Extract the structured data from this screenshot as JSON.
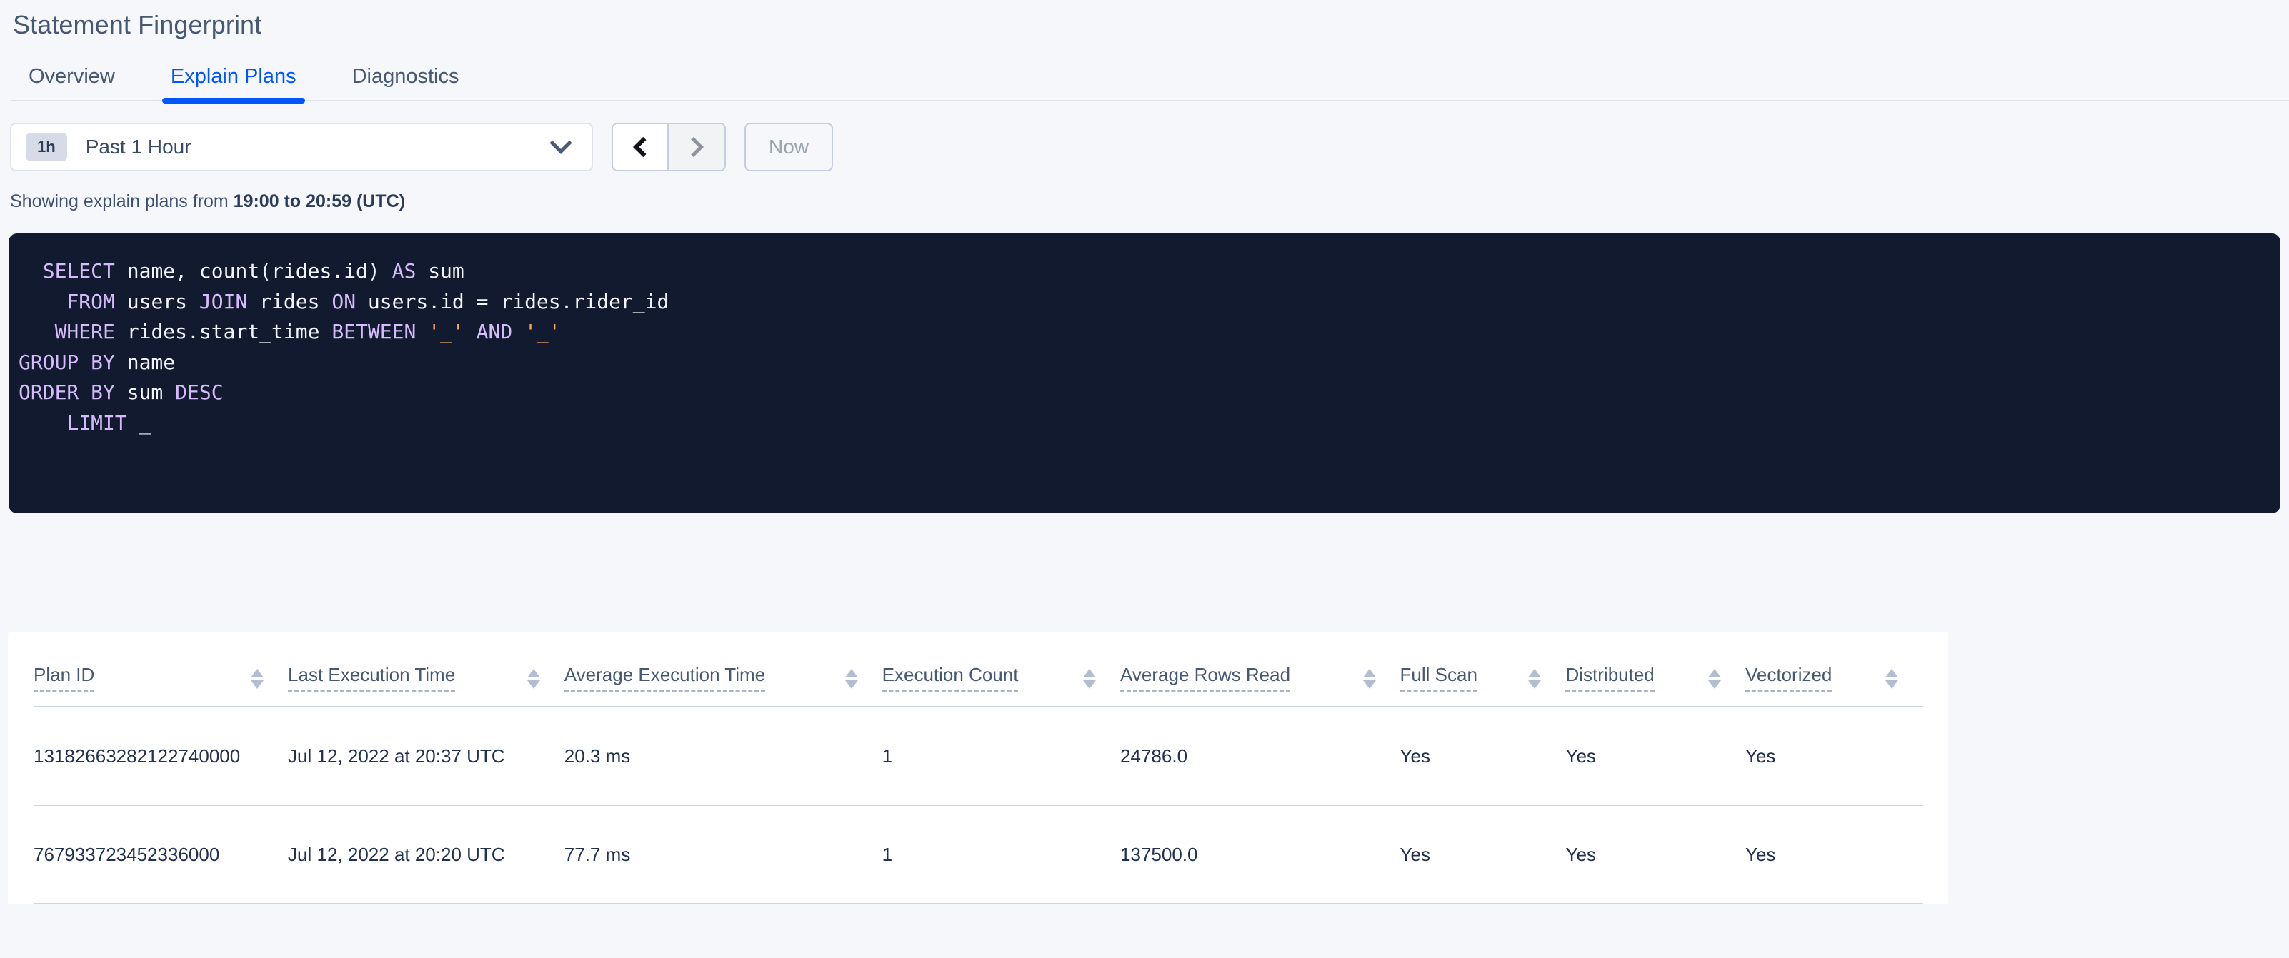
{
  "page": {
    "title": "Statement Fingerprint"
  },
  "tabs": [
    {
      "label": "Overview",
      "active": false
    },
    {
      "label": "Explain Plans",
      "active": true
    },
    {
      "label": "Diagnostics",
      "active": false
    }
  ],
  "toolbar": {
    "time_badge": "1h",
    "time_label": "Past 1 Hour",
    "prev_icon": "chevron-left-icon",
    "next_icon": "chevron-right-icon",
    "now_label": "Now",
    "dropdown_icon": "chevron-down-icon"
  },
  "range_note": {
    "prefix": "Showing explain plans from ",
    "range": "19:00 to 20:59 (UTC)"
  },
  "sql": {
    "lines": [
      [
        {
          "t": "  ",
          "c": "id"
        },
        {
          "t": "SELECT",
          "c": "kw"
        },
        {
          "t": " name, ",
          "c": "id"
        },
        {
          "t": "count",
          "c": "id"
        },
        {
          "t": "(rides.id) ",
          "c": "id"
        },
        {
          "t": "AS",
          "c": "kw"
        },
        {
          "t": " sum",
          "c": "id"
        }
      ],
      [
        {
          "t": "    ",
          "c": "id"
        },
        {
          "t": "FROM",
          "c": "kw"
        },
        {
          "t": " users ",
          "c": "id"
        },
        {
          "t": "JOIN",
          "c": "kw"
        },
        {
          "t": " rides ",
          "c": "id"
        },
        {
          "t": "ON",
          "c": "kw"
        },
        {
          "t": " users.id = rides.rider_id",
          "c": "id"
        }
      ],
      [
        {
          "t": "   ",
          "c": "id"
        },
        {
          "t": "WHERE",
          "c": "kw"
        },
        {
          "t": " rides.start_time ",
          "c": "id"
        },
        {
          "t": "BETWEEN",
          "c": "kw"
        },
        {
          "t": " ",
          "c": "id"
        },
        {
          "t": "'_'",
          "c": "str"
        },
        {
          "t": " ",
          "c": "id"
        },
        {
          "t": "AND",
          "c": "kw"
        },
        {
          "t": " ",
          "c": "id"
        },
        {
          "t": "'_'",
          "c": "str"
        }
      ],
      [
        {
          "t": "GROUP BY",
          "c": "kw"
        },
        {
          "t": " name",
          "c": "id"
        }
      ],
      [
        {
          "t": "ORDER BY",
          "c": "kw"
        },
        {
          "t": " sum ",
          "c": "id"
        },
        {
          "t": "DESC",
          "c": "kw"
        }
      ],
      [
        {
          "t": "    ",
          "c": "id"
        },
        {
          "t": "LIMIT",
          "c": "kw"
        },
        {
          "t": " _",
          "c": "id"
        }
      ]
    ],
    "raw": "  SELECT name, count(rides.id) AS sum\n    FROM users JOIN rides ON users.id = rides.rider_id\n   WHERE rides.start_time BETWEEN '_' AND '_'\nGROUP BY name\nORDER BY sum DESC\n    LIMIT _"
  },
  "table": {
    "columns": [
      "Plan ID",
      "Last Execution Time",
      "Average Execution Time",
      "Execution Count",
      "Average Rows Read",
      "Full Scan",
      "Distributed",
      "Vectorized"
    ],
    "rows": [
      {
        "plan_id": "13182663282122740000",
        "last_execution_time": "Jul 12, 2022 at 20:37 UTC",
        "average_execution_time": "20.3 ms",
        "execution_count": "1",
        "average_rows_read": "24786.0",
        "full_scan": "Yes",
        "distributed": "Yes",
        "vectorized": "Yes"
      },
      {
        "plan_id": "767933723452336000",
        "last_execution_time": "Jul 12, 2022 at 20:20 UTC",
        "average_execution_time": "77.7 ms",
        "execution_count": "1",
        "average_rows_read": "137500.0",
        "full_scan": "Yes",
        "distributed": "Yes",
        "vectorized": "Yes"
      }
    ]
  },
  "colors": {
    "accent": "#0055ff",
    "page_background": "#f5f7fa",
    "sql_background": "#111a2e",
    "sql_keyword": "#d4bbf9",
    "sql_identifier": "#f2f4fb",
    "sql_string": "#f0a868",
    "text": "#22314f"
  }
}
